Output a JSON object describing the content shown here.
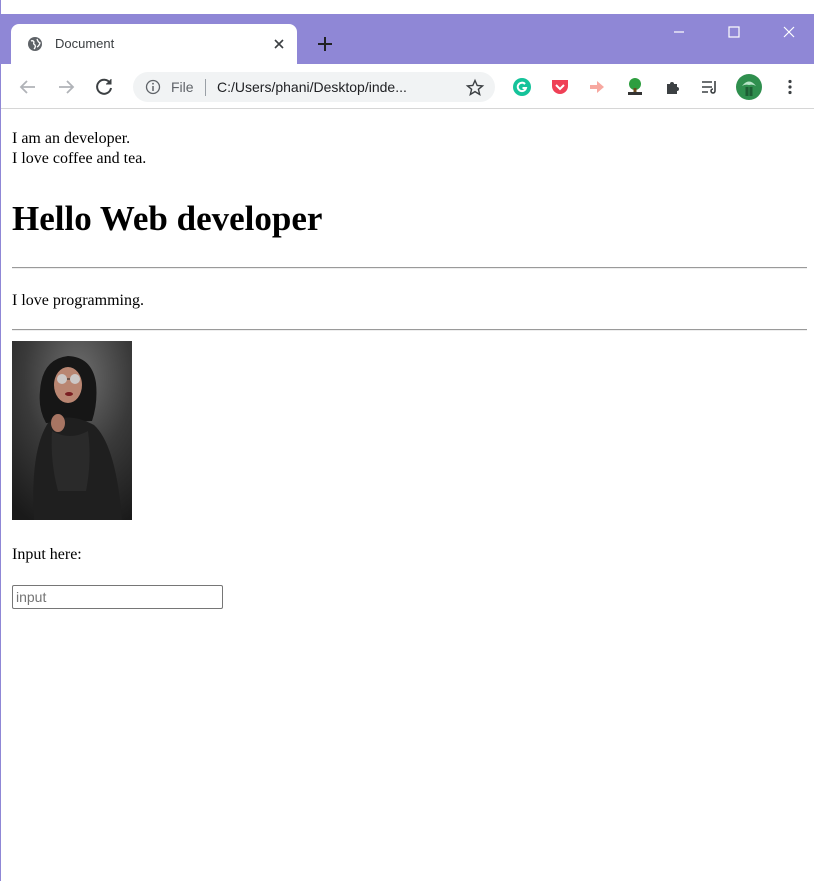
{
  "browser": {
    "tab": {
      "title": "Document",
      "favicon": "globe-icon"
    },
    "new_tab_icon": "plus-icon",
    "window_controls": [
      "minimize-icon",
      "maximize-icon",
      "close-icon"
    ],
    "toolbar": {
      "back_icon": "back-arrow-icon",
      "forward_icon": "forward-arrow-icon",
      "reload_icon": "reload-icon",
      "omnibox": {
        "scheme_label": "File",
        "url": "C:/Users/phani/Desktop/inde...",
        "info_icon": "info-icon",
        "bookmark_icon": "star-icon"
      },
      "extensions": [
        "grammarly-icon",
        "pocket-icon",
        "extension-arrow-icon",
        "tree-html-icon",
        "puzzle-icon",
        "reading-list-icon",
        "profile-avatar-icon",
        "kebab-menu-icon"
      ]
    },
    "colors": {
      "frame": "#8f87d6",
      "omnibox_bg": "#f1f3f4"
    }
  },
  "page": {
    "intro_line1": "I am an developer.",
    "intro_line2": "I love coffee and tea.",
    "heading": "Hello Web developer",
    "paragraph": "I love programming.",
    "input_label": "Input here:",
    "input_placeholder": "input",
    "input_value": ""
  }
}
